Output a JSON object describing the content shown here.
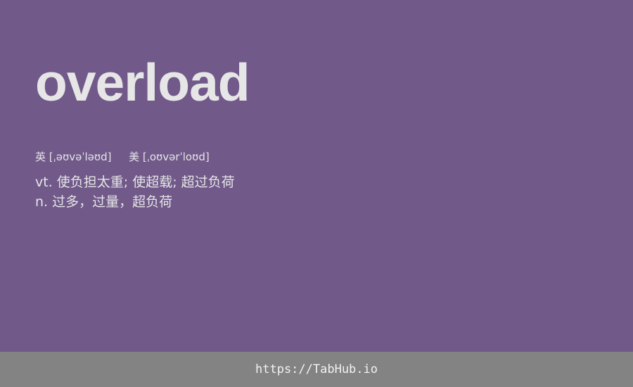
{
  "word": "overload",
  "phonetics": {
    "uk_label": "英",
    "uk_ipa": "[ˌəʊvəˈləʊd]",
    "us_label": "美",
    "us_ipa": "[ˌoʊvərˈloʊd]"
  },
  "definitions": [
    "vt. 使负担太重; 使超载; 超过负荷",
    "n. 过多，过量，超负荷"
  ],
  "footer": {
    "link_text": "https://TabHub.io"
  },
  "colors": {
    "background": "#71598a",
    "footer_background": "#838383",
    "text": "#e6e6e6"
  }
}
